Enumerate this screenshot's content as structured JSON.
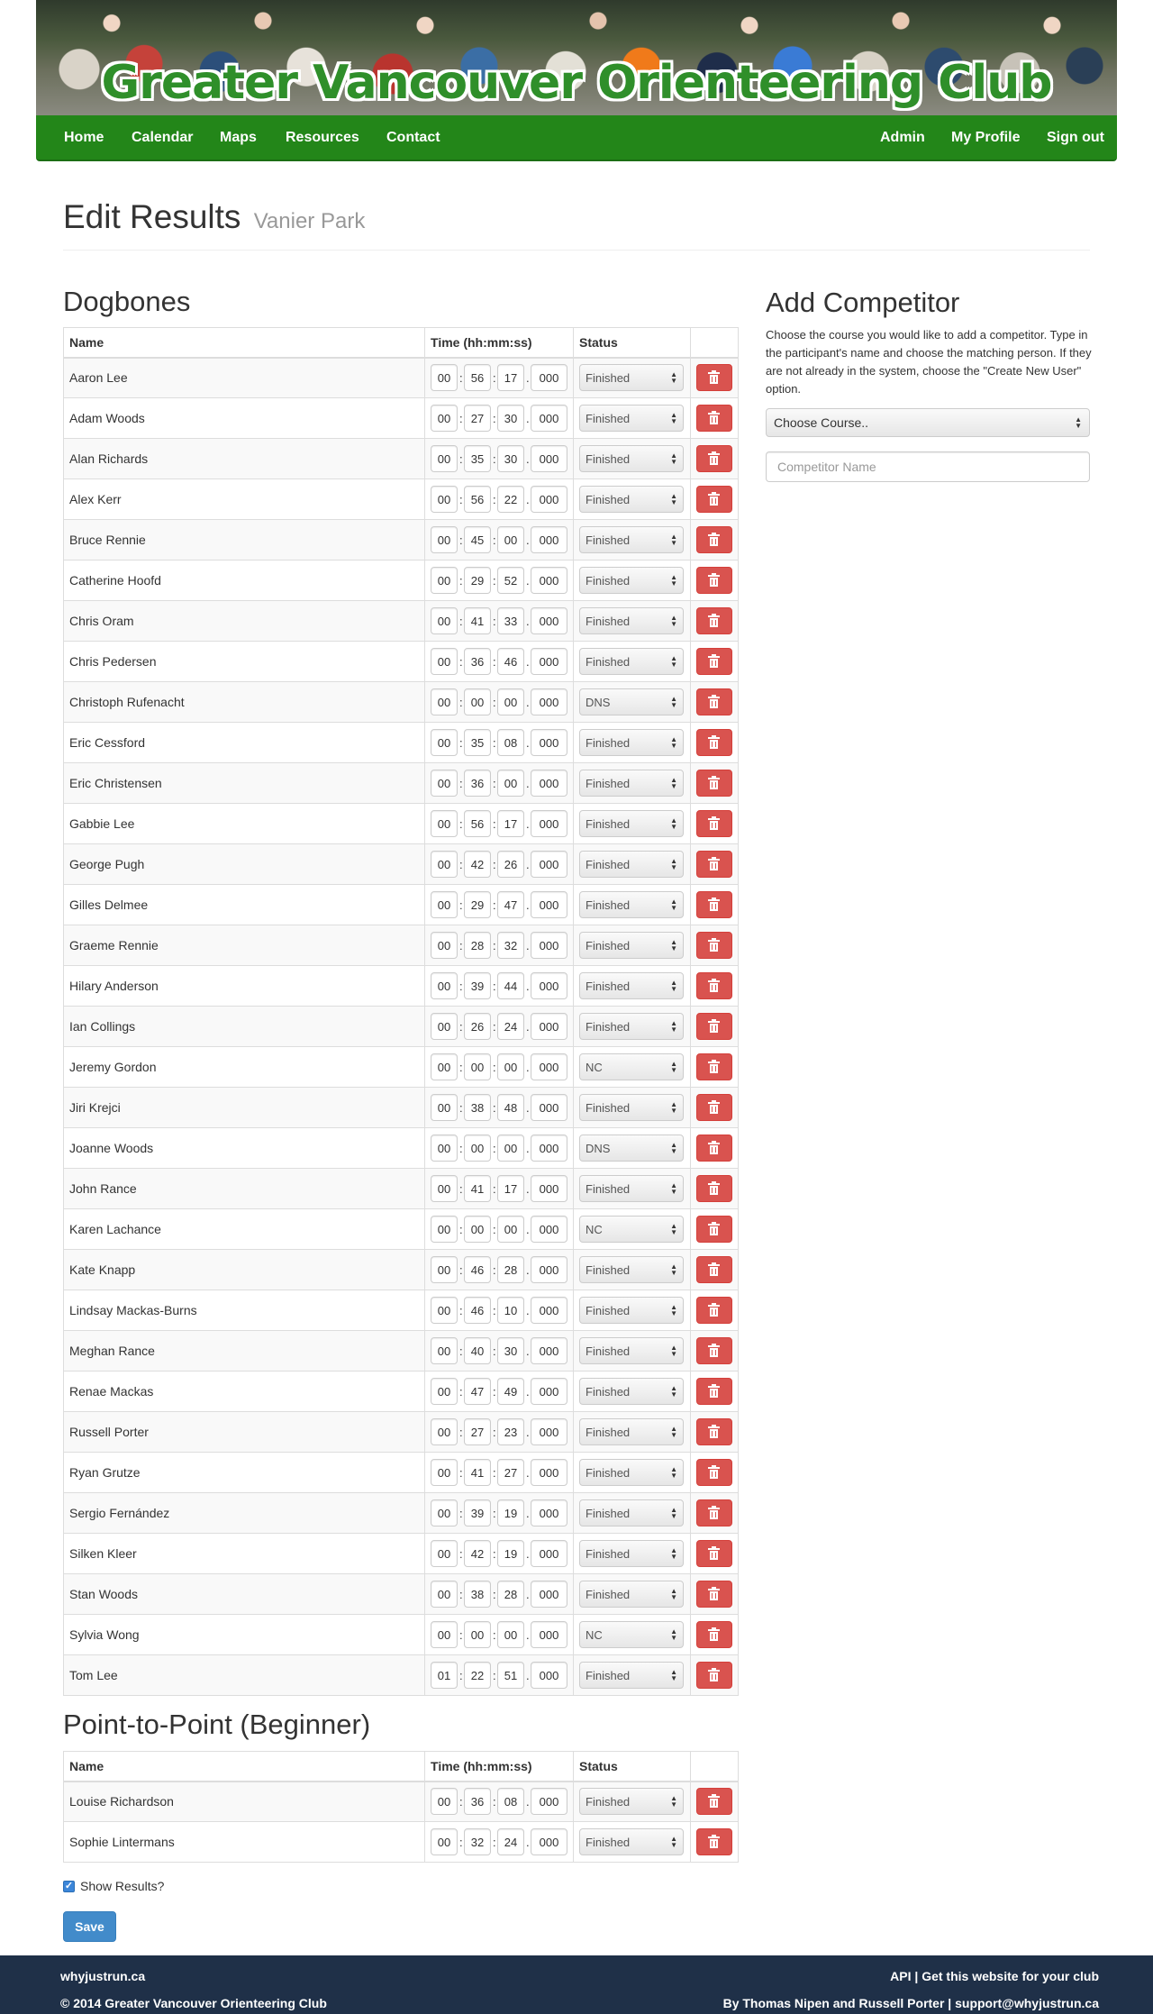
{
  "header": {
    "club_title": "Greater Vancouver Orienteering Club"
  },
  "nav": {
    "left": [
      "Home",
      "Calendar",
      "Maps",
      "Resources",
      "Contact"
    ],
    "right": [
      "Admin",
      "My Profile",
      "Sign out"
    ]
  },
  "page": {
    "title": "Edit Results",
    "subtitle": "Vanier Park"
  },
  "columns": {
    "name": "Name",
    "time": "Time (hh:mm:ss)",
    "status": "Status"
  },
  "courses": [
    {
      "name": "Dogbones",
      "rows": [
        {
          "name": "Aaron Lee",
          "h": "00",
          "m": "56",
          "s": "17",
          "ms": "000",
          "status": "Finished"
        },
        {
          "name": "Adam Woods",
          "h": "00",
          "m": "27",
          "s": "30",
          "ms": "000",
          "status": "Finished"
        },
        {
          "name": "Alan Richards",
          "h": "00",
          "m": "35",
          "s": "30",
          "ms": "000",
          "status": "Finished"
        },
        {
          "name": "Alex Kerr",
          "h": "00",
          "m": "56",
          "s": "22",
          "ms": "000",
          "status": "Finished"
        },
        {
          "name": "Bruce Rennie",
          "h": "00",
          "m": "45",
          "s": "00",
          "ms": "000",
          "status": "Finished"
        },
        {
          "name": "Catherine Hoofd",
          "h": "00",
          "m": "29",
          "s": "52",
          "ms": "000",
          "status": "Finished"
        },
        {
          "name": "Chris Oram",
          "h": "00",
          "m": "41",
          "s": "33",
          "ms": "000",
          "status": "Finished"
        },
        {
          "name": "Chris Pedersen",
          "h": "00",
          "m": "36",
          "s": "46",
          "ms": "000",
          "status": "Finished"
        },
        {
          "name": "Christoph Rufenacht",
          "h": "00",
          "m": "00",
          "s": "00",
          "ms": "000",
          "status": "DNS"
        },
        {
          "name": "Eric Cessford",
          "h": "00",
          "m": "35",
          "s": "08",
          "ms": "000",
          "status": "Finished"
        },
        {
          "name": "Eric Christensen",
          "h": "00",
          "m": "36",
          "s": "00",
          "ms": "000",
          "status": "Finished"
        },
        {
          "name": "Gabbie Lee",
          "h": "00",
          "m": "56",
          "s": "17",
          "ms": "000",
          "status": "Finished"
        },
        {
          "name": "George Pugh",
          "h": "00",
          "m": "42",
          "s": "26",
          "ms": "000",
          "status": "Finished"
        },
        {
          "name": "Gilles Delmee",
          "h": "00",
          "m": "29",
          "s": "47",
          "ms": "000",
          "status": "Finished"
        },
        {
          "name": "Graeme Rennie",
          "h": "00",
          "m": "28",
          "s": "32",
          "ms": "000",
          "status": "Finished"
        },
        {
          "name": "Hilary Anderson",
          "h": "00",
          "m": "39",
          "s": "44",
          "ms": "000",
          "status": "Finished"
        },
        {
          "name": "Ian Collings",
          "h": "00",
          "m": "26",
          "s": "24",
          "ms": "000",
          "status": "Finished"
        },
        {
          "name": "Jeremy Gordon",
          "h": "00",
          "m": "00",
          "s": "00",
          "ms": "000",
          "status": "NC"
        },
        {
          "name": "Jiri Krejci",
          "h": "00",
          "m": "38",
          "s": "48",
          "ms": "000",
          "status": "Finished"
        },
        {
          "name": "Joanne Woods",
          "h": "00",
          "m": "00",
          "s": "00",
          "ms": "000",
          "status": "DNS"
        },
        {
          "name": "John Rance",
          "h": "00",
          "m": "41",
          "s": "17",
          "ms": "000",
          "status": "Finished"
        },
        {
          "name": "Karen Lachance",
          "h": "00",
          "m": "00",
          "s": "00",
          "ms": "000",
          "status": "NC"
        },
        {
          "name": "Kate Knapp",
          "h": "00",
          "m": "46",
          "s": "28",
          "ms": "000",
          "status": "Finished"
        },
        {
          "name": "Lindsay Mackas-Burns",
          "h": "00",
          "m": "46",
          "s": "10",
          "ms": "000",
          "status": "Finished"
        },
        {
          "name": "Meghan Rance",
          "h": "00",
          "m": "40",
          "s": "30",
          "ms": "000",
          "status": "Finished"
        },
        {
          "name": "Renae Mackas",
          "h": "00",
          "m": "47",
          "s": "49",
          "ms": "000",
          "status": "Finished"
        },
        {
          "name": "Russell Porter",
          "h": "00",
          "m": "27",
          "s": "23",
          "ms": "000",
          "status": "Finished"
        },
        {
          "name": "Ryan Grutze",
          "h": "00",
          "m": "41",
          "s": "27",
          "ms": "000",
          "status": "Finished"
        },
        {
          "name": "Sergio Fernández",
          "h": "00",
          "m": "39",
          "s": "19",
          "ms": "000",
          "status": "Finished"
        },
        {
          "name": "Silken Kleer",
          "h": "00",
          "m": "42",
          "s": "19",
          "ms": "000",
          "status": "Finished"
        },
        {
          "name": "Stan Woods",
          "h": "00",
          "m": "38",
          "s": "28",
          "ms": "000",
          "status": "Finished"
        },
        {
          "name": "Sylvia Wong",
          "h": "00",
          "m": "00",
          "s": "00",
          "ms": "000",
          "status": "NC"
        },
        {
          "name": "Tom Lee",
          "h": "01",
          "m": "22",
          "s": "51",
          "ms": "000",
          "status": "Finished"
        }
      ]
    },
    {
      "name": "Point-to-Point (Beginner)",
      "rows": [
        {
          "name": "Louise Richardson",
          "h": "00",
          "m": "36",
          "s": "08",
          "ms": "000",
          "status": "Finished"
        },
        {
          "name": "Sophie Lintermans",
          "h": "00",
          "m": "32",
          "s": "24",
          "ms": "000",
          "status": "Finished"
        }
      ]
    }
  ],
  "add_competitor": {
    "title": "Add Competitor",
    "help": "Choose the course you would like to add a competitor. Type in the participant's name and choose the matching person. If they are not already in the system, choose the \"Create New User\" option.",
    "course_select": "Choose Course..",
    "name_placeholder": "Competitor Name"
  },
  "form": {
    "show_results_label": "Show Results?",
    "show_results_checked": true,
    "save_label": "Save"
  },
  "footer": {
    "site": "whyjustrun.ca",
    "copyright": "© 2014 Greater Vancouver Orienteering Club",
    "links": "API | Get this website for your club",
    "credits": "By Thomas Nipen and Russell Porter | support@whyjustrun.ca"
  },
  "colors": {
    "nav_green": "#238619",
    "danger": "#d9534f",
    "primary": "#428bca",
    "footer": "#1f3048"
  }
}
